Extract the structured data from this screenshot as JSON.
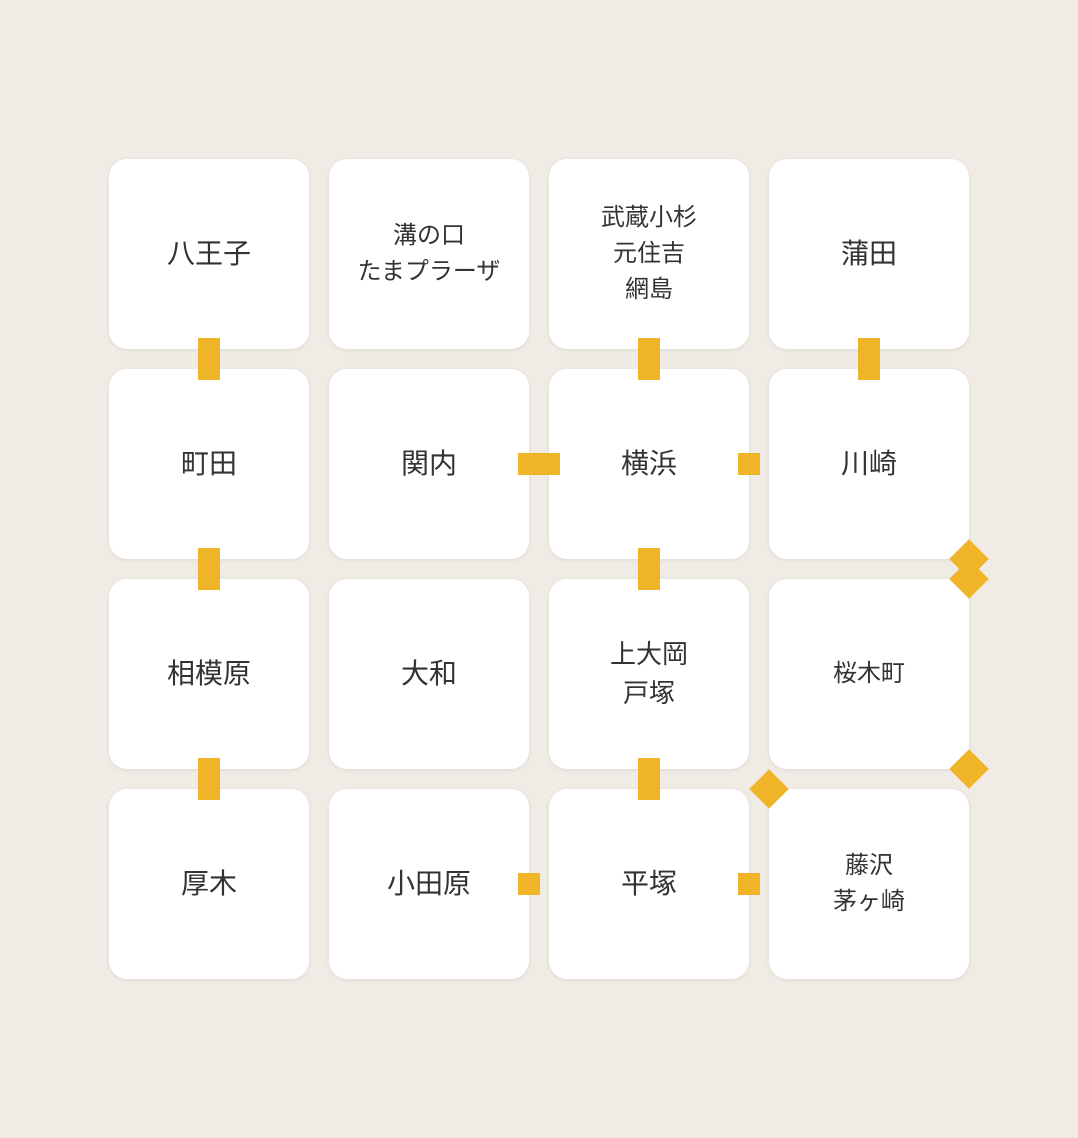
{
  "grid": {
    "background": "#f0ebe4",
    "accent_color": "#f0b429",
    "rows": [
      [
        {
          "id": "hachioji",
          "label": "八王子",
          "connectors": [
            "bottom"
          ]
        },
        {
          "id": "mizonokuchi",
          "label": "溝の口\nたまプラーザ",
          "connectors": []
        },
        {
          "id": "musashikosugi",
          "label": "武蔵小杉\n元住吉\n網島",
          "connectors": [
            "bottom"
          ]
        },
        {
          "id": "kamata",
          "label": "蒲田",
          "connectors": [
            "bottom"
          ]
        }
      ],
      [
        {
          "id": "machida",
          "label": "町田",
          "connectors": [
            "bottom"
          ]
        },
        {
          "id": "kannai",
          "label": "関内",
          "connectors": [
            "right"
          ]
        },
        {
          "id": "yokohama",
          "label": "横浜",
          "connectors": [
            "bottom",
            "left",
            "right"
          ]
        },
        {
          "id": "kawasaki",
          "label": "川崎",
          "connectors": [
            "diag-bottom-right"
          ]
        }
      ],
      [
        {
          "id": "sagamihara",
          "label": "相模原",
          "connectors": [
            "bottom"
          ]
        },
        {
          "id": "yamato",
          "label": "大和",
          "connectors": []
        },
        {
          "id": "kamiooka",
          "label": "上大岡\n戸塚",
          "connectors": [
            "bottom"
          ]
        },
        {
          "id": "sakuragicho",
          "label": "桜木町",
          "connectors": [
            "diag-top-right",
            "diag-bottom-right"
          ]
        }
      ],
      [
        {
          "id": "atsugi",
          "label": "厚木",
          "connectors": []
        },
        {
          "id": "odawara",
          "label": "小田原",
          "connectors": [
            "right"
          ]
        },
        {
          "id": "hiratsuka",
          "label": "平塚",
          "connectors": [
            "right"
          ]
        },
        {
          "id": "fujisawa",
          "label": "藤沢\n茅ヶ崎",
          "connectors": [
            "diag-top-left"
          ]
        }
      ]
    ]
  }
}
